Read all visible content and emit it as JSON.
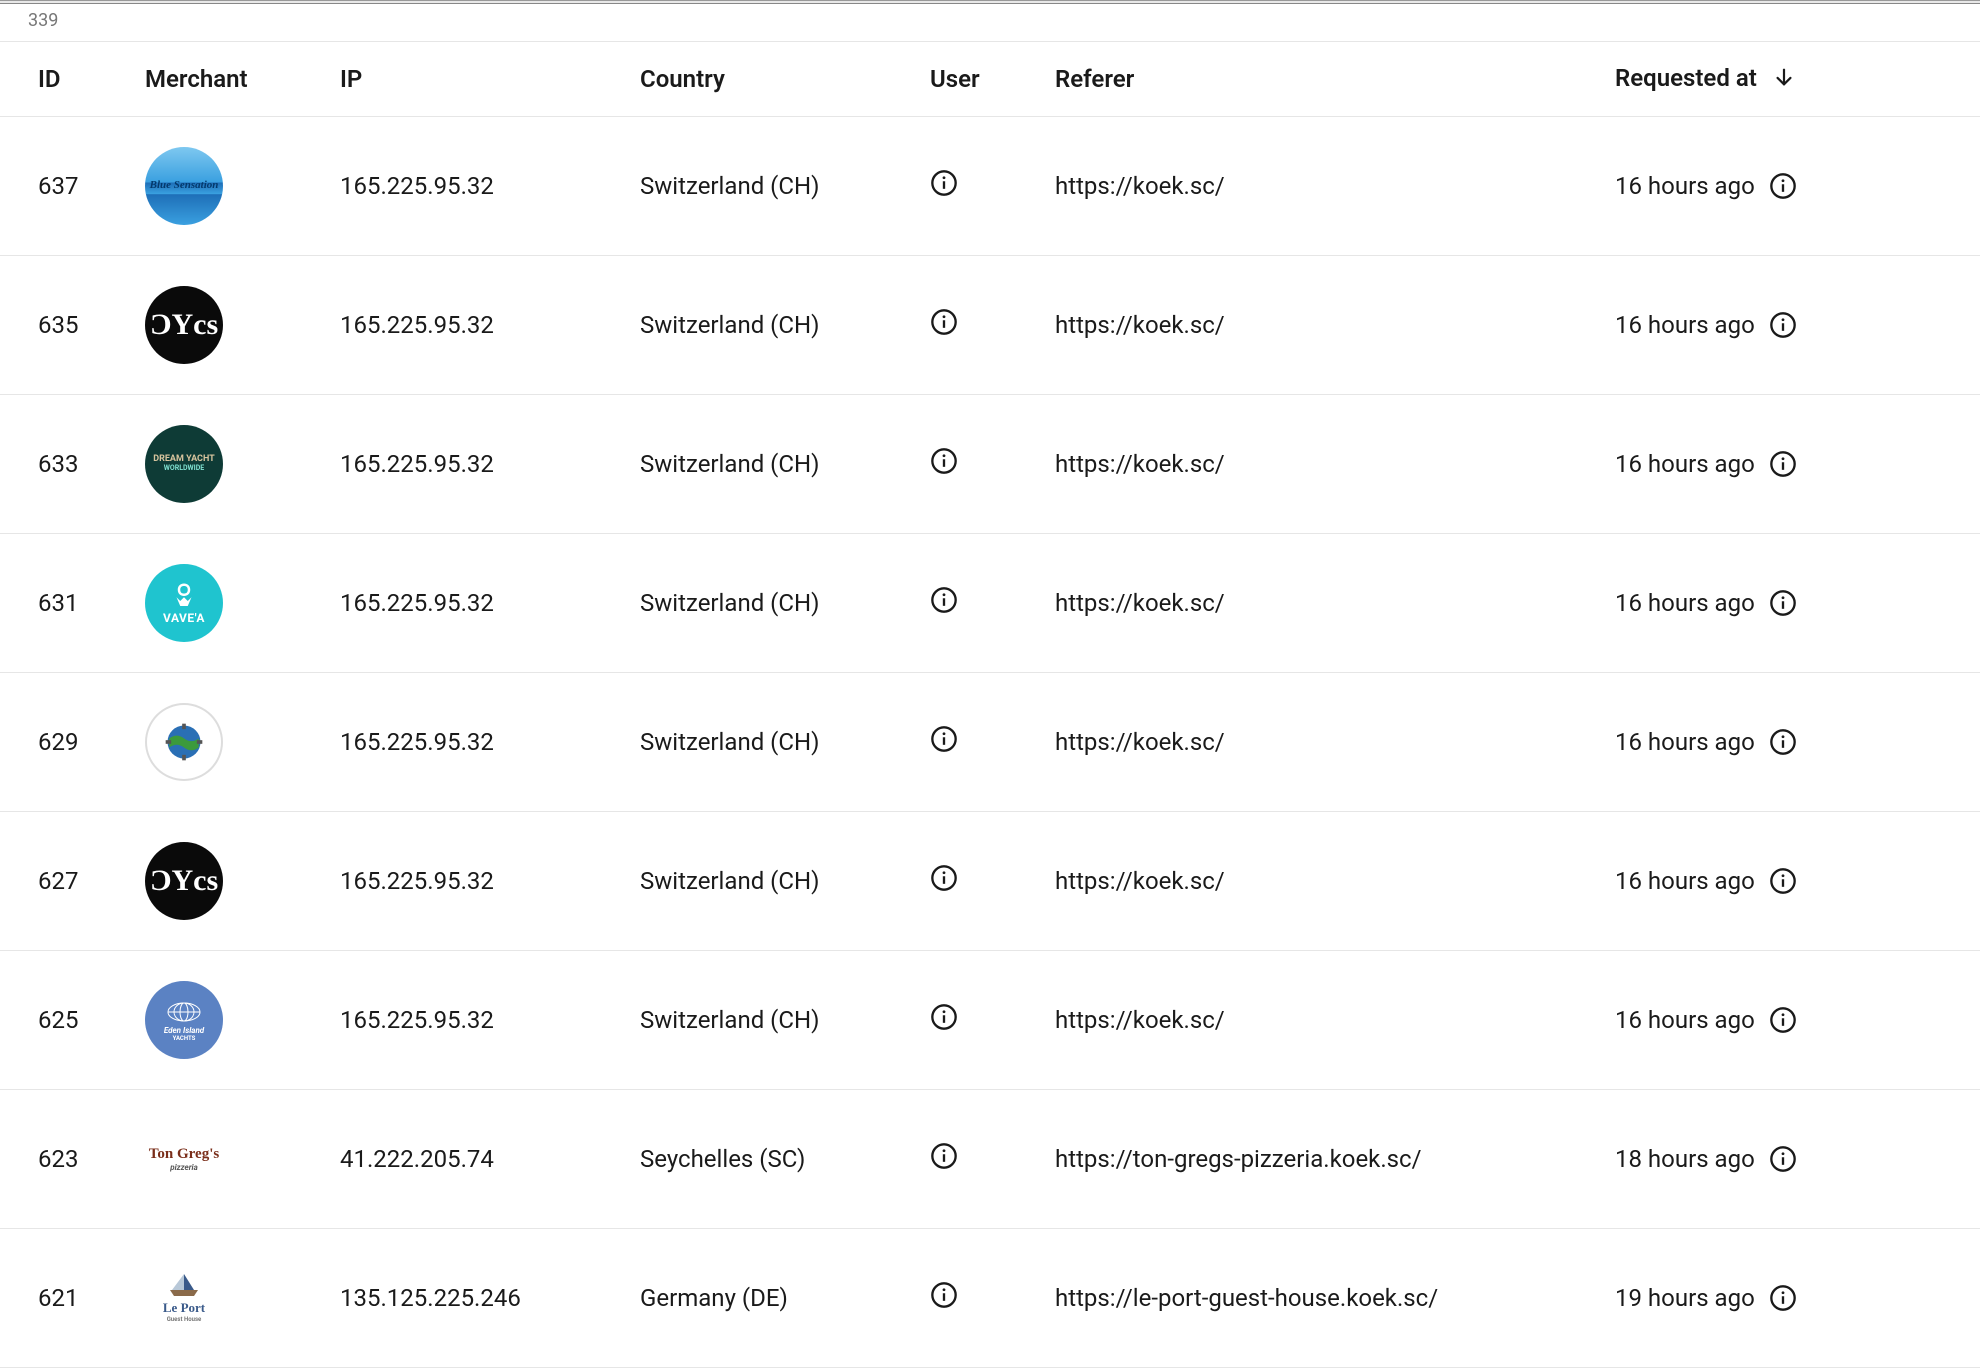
{
  "count_label": "339",
  "columns": {
    "id": "ID",
    "merchant": "Merchant",
    "ip": "IP",
    "country": "Country",
    "user": "User",
    "referer": "Referer",
    "requested_at": "Requested at"
  },
  "sort": {
    "column": "requested_at",
    "direction": "desc"
  },
  "rows": [
    {
      "id": "637",
      "ip": "165.225.95.32",
      "country": "Switzerland (CH)",
      "referer": "https://koek.sc/",
      "requested_at": "16 hours ago",
      "merchant_style": "wave",
      "merchant_text": "Blue Sensation"
    },
    {
      "id": "635",
      "ip": "165.225.95.32",
      "country": "Switzerland (CH)",
      "referer": "https://koek.sc/",
      "requested_at": "16 hours ago",
      "merchant_style": "black",
      "merchant_text": "Ycs"
    },
    {
      "id": "633",
      "ip": "165.225.95.32",
      "country": "Switzerland (CH)",
      "referer": "https://koek.sc/",
      "requested_at": "16 hours ago",
      "merchant_style": "green-dark",
      "merchant_text": "DREAM YACHT"
    },
    {
      "id": "631",
      "ip": "165.225.95.32",
      "country": "Switzerland (CH)",
      "referer": "https://koek.sc/",
      "requested_at": "16 hours ago",
      "merchant_style": "teal",
      "merchant_text": "VAVE'A"
    },
    {
      "id": "629",
      "ip": "165.225.95.32",
      "country": "Switzerland (CH)",
      "referer": "https://koek.sc/",
      "requested_at": "16 hours ago",
      "merchant_style": "white-ring",
      "merchant_text": "globe"
    },
    {
      "id": "627",
      "ip": "165.225.95.32",
      "country": "Switzerland (CH)",
      "referer": "https://koek.sc/",
      "requested_at": "16 hours ago",
      "merchant_style": "black",
      "merchant_text": "Ycs"
    },
    {
      "id": "625",
      "ip": "165.225.95.32",
      "country": "Switzerland (CH)",
      "referer": "https://koek.sc/",
      "requested_at": "16 hours ago",
      "merchant_style": "steelblue",
      "merchant_text": "Eden Island"
    },
    {
      "id": "623",
      "ip": "41.222.205.74",
      "country": "Seychelles (SC)",
      "referer": "https://ton-gregs-pizzeria.koek.sc/",
      "requested_at": "18 hours ago",
      "merchant_style": "plain",
      "merchant_text": "Ton Greg's"
    },
    {
      "id": "621",
      "ip": "135.125.225.246",
      "country": "Germany (DE)",
      "referer": "https://le-port-guest-house.koek.sc/",
      "requested_at": "19 hours ago",
      "merchant_style": "plain",
      "merchant_text": "Le Port"
    }
  ]
}
